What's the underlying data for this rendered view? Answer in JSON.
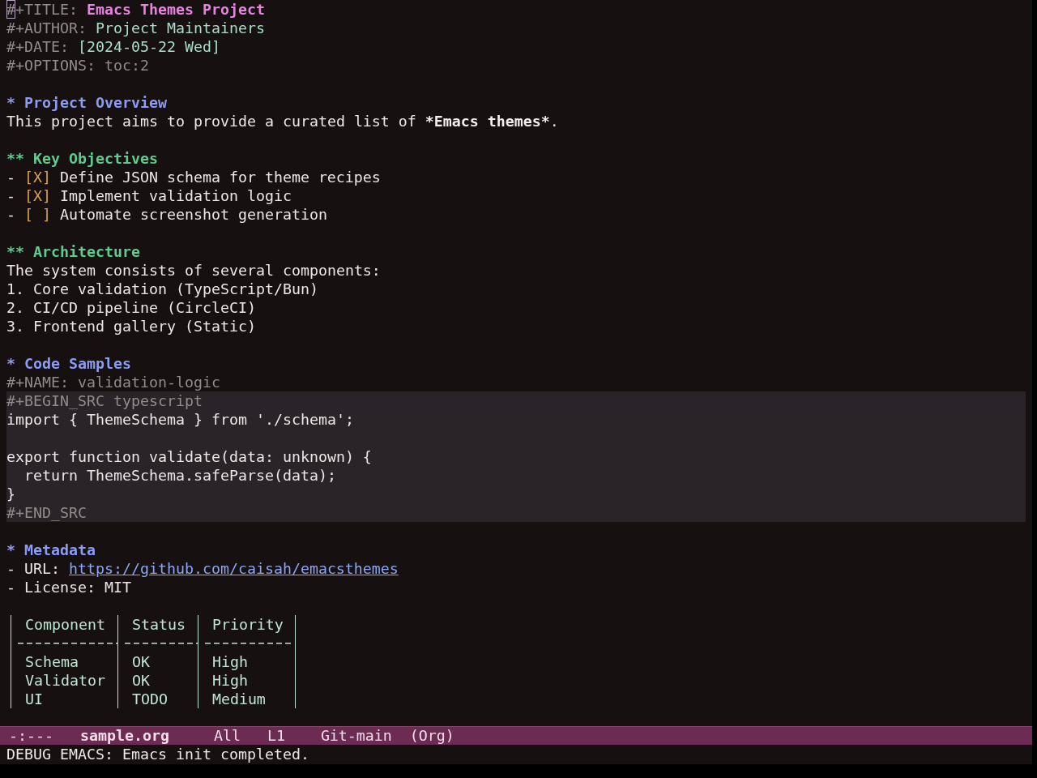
{
  "keywords": [
    {
      "kind": "title",
      "key": "#+TITLE:",
      "value": "Emacs Themes Project",
      "cursor": true
    },
    {
      "kind": "author",
      "key": "#+AUTHOR:",
      "value": "Project Maintainers",
      "cursor": false
    },
    {
      "kind": "date",
      "key": "#+DATE:",
      "value": "[2024-05-22 Wed]",
      "cursor": false
    },
    {
      "kind": "options",
      "key": "#+OPTIONS:",
      "value": "toc:2",
      "cursor": false
    }
  ],
  "sections": [
    {
      "heading": "* Project Overview",
      "body": [
        {
          "kind": "paragraph",
          "segments": [
            {
              "text": "This project aims to provide a curated list of ",
              "bold": false
            },
            {
              "text": "*Emacs themes*",
              "bold": true
            },
            {
              "text": ".",
              "bold": false
            }
          ]
        }
      ],
      "children": [
        {
          "heading": "** Key Objectives",
          "body": [
            {
              "kind": "checkbox",
              "bullet": "-",
              "box": "[X]",
              "text": "Define JSON schema for theme recipes"
            },
            {
              "kind": "checkbox",
              "bullet": "-",
              "box": "[X]",
              "text": "Implement validation logic"
            },
            {
              "kind": "checkbox",
              "bullet": "-",
              "box": "[ ]",
              "text": "Automate screenshot generation"
            }
          ]
        },
        {
          "heading": "** Architecture",
          "body": [
            {
              "kind": "text",
              "text": "The system consists of several components:"
            },
            {
              "kind": "text",
              "text": "1. Core validation (TypeScript/Bun)"
            },
            {
              "kind": "text",
              "text": "2. CI/CD pipeline (CircleCI)"
            },
            {
              "kind": "text",
              "text": "3. Frontend gallery (Static)"
            }
          ]
        }
      ]
    },
    {
      "heading": "* Code Samples",
      "body": [
        {
          "kind": "meta",
          "text": "#+NAME: validation-logic"
        },
        {
          "kind": "src",
          "begin": "#+BEGIN_SRC typescript",
          "lines": [
            {
              "kind": "code",
              "text": "import { ThemeSchema } from './schema';"
            },
            {
              "kind": "blank"
            },
            {
              "kind": "code",
              "text": "export function validate(data: unknown) {"
            },
            {
              "kind": "code",
              "text": "  return ThemeSchema.safeParse(data);"
            },
            {
              "kind": "code",
              "text": "}"
            }
          ],
          "end": "#+END_SRC"
        }
      ]
    },
    {
      "heading": "* Metadata",
      "body": [
        {
          "kind": "link",
          "label": "- URL:",
          "url": "https://github.com/caisah/emacsthemes"
        },
        {
          "kind": "text",
          "text": "- License: MIT"
        },
        {
          "kind": "blank"
        },
        {
          "kind": "table",
          "columns": [
            "Component",
            "Status",
            "Priority"
          ],
          "rows": [
            [
              "Schema",
              "OK",
              "High"
            ],
            [
              "Validator",
              "OK",
              "High"
            ],
            [
              "UI",
              "TODO",
              "Medium"
            ]
          ]
        }
      ]
    }
  ],
  "mode_line": {
    "status": "-:---",
    "buffer": "sample.org",
    "position": "All",
    "line": "L1",
    "branch": "Git-main",
    "mode": "(Org)"
  },
  "echo_area": "DEBUG EMACS: Emacs init completed."
}
